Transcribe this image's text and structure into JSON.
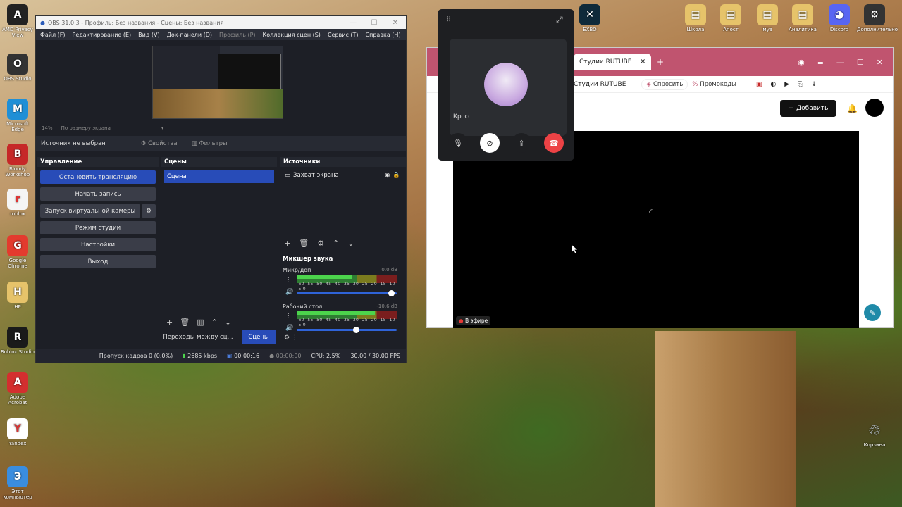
{
  "desktop": {
    "icons": [
      {
        "label": "AMD Privacy View",
        "icon": "amd-icon",
        "color": "#222"
      },
      {
        "label": "OBS Studio",
        "icon": "obs-icon",
        "color": "#333"
      },
      {
        "label": "Microsoft Edge",
        "icon": "edge-icon",
        "color": "#1f8fd6"
      },
      {
        "label": "Bloody Workshop",
        "icon": "bloody-icon",
        "color": "#c62828"
      },
      {
        "label": "roblox",
        "icon": "file-icon",
        "color": "#f5f5f5"
      },
      {
        "label": "Google Chrome",
        "icon": "chrome-icon",
        "color": "#e33b2e"
      },
      {
        "label": "HP",
        "icon": "folder-icon",
        "color": "#e6c36a"
      },
      {
        "label": "Roblox Studio",
        "icon": "roblox-studio-icon",
        "color": "#1a1a1a"
      },
      {
        "label": "Adobe Acrobat",
        "icon": "acrobat-icon",
        "color": "#d32f2f"
      },
      {
        "label": "Yandex",
        "icon": "yandex-icon",
        "color": "#ffffff"
      },
      {
        "label": "Этот компьютер",
        "icon": "computer-icon",
        "color": "#3a8ddf"
      }
    ],
    "right_icons": [
      {
        "label": "Школа",
        "icon": "folder-icon"
      },
      {
        "label": "Апост",
        "icon": "folder-icon"
      },
      {
        "label": "муз",
        "icon": "folder-icon"
      },
      {
        "label": "Аналитика",
        "icon": "folder-icon"
      },
      {
        "label": "Discord",
        "icon": "discord-icon"
      },
      {
        "label": "Дополнительно",
        "icon": "settings-icon"
      }
    ],
    "top_right_icon": "EXBO",
    "recycle_bin": "Корзина"
  },
  "obs": {
    "title": "OBS 31.0.3 - Профиль: Без названия - Сцены: Без названия",
    "menu": [
      "Файл (F)",
      "Редактирование (E)",
      "Вид (V)",
      "Док-панели (D)",
      "Профиль (P)",
      "Коллекция сцен (S)",
      "Сервис (T)",
      "Справка (H)"
    ],
    "zoom": "14%",
    "zoom_mode": "По размеру экрана",
    "no_source": "Источник не выбран",
    "properties": "Свойства",
    "filters": "Фильтры",
    "controls_header": "Управление",
    "controls": [
      "Остановить трансляцию",
      "Начать запись",
      "Запуск виртуальной камеры",
      "Режим студии",
      "Настройки",
      "Выход"
    ],
    "scenes_header": "Сцены",
    "scene_item": "Сцена",
    "sources_header": "Источники",
    "source_item": "Захват экрана",
    "mixer_header": "Микшер звука",
    "tracks": [
      {
        "name": "Микр/доп",
        "db": "0.0 dB",
        "level": 0.55,
        "volume": 0.95
      },
      {
        "name": "Рабочий стол",
        "db": "-10.6 dB",
        "level": 0.78,
        "volume": 0.6
      }
    ],
    "meter_ticks": "-60 -55 -50 -45 -40 -35 -30 -25 -20 -15 -10 -5 0",
    "transitions_tab": "Переходы между сц...",
    "scenes_tab": "Сцены",
    "status": {
      "dropped": "Пропуск кадров 0 (0.0%)",
      "bitrate": "2685 kbps",
      "live_time": "00:00:16",
      "rec_time": "00:00:00",
      "cpu": "CPU: 2.5%",
      "fps": "30.00 / 30.00 FPS"
    }
  },
  "browser": {
    "tab_title": "Студии RUTUBE",
    "page_title": "Студии RUTUBE",
    "ask": "Спросить",
    "promo": "Промокоды",
    "add_button": "Добавить",
    "live_badge": "В эфире"
  },
  "call": {
    "user": "Кросс",
    "colors": {
      "hangup": "#ed4245",
      "button": "#2b2d31",
      "active": "#ffffff"
    }
  }
}
